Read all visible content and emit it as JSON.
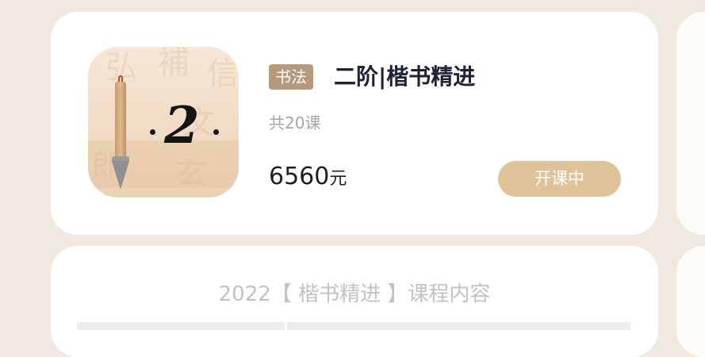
{
  "course": {
    "tag": "书法",
    "title": "二阶|楷书精进",
    "lessons": "共20课",
    "price_amount": "6560",
    "price_unit": "元",
    "status": "开课中"
  },
  "thumbnail": {
    "numeral": "2"
  },
  "content": {
    "title": "2022【 楷书精进 】课程内容"
  },
  "colors": {
    "tag_bg": "#b8987a",
    "status_bg": "#e0c299",
    "title_text": "#1f2235",
    "page_bg": "#efe9e2"
  },
  "icons": [
    "calligraphy-brush-icon"
  ]
}
